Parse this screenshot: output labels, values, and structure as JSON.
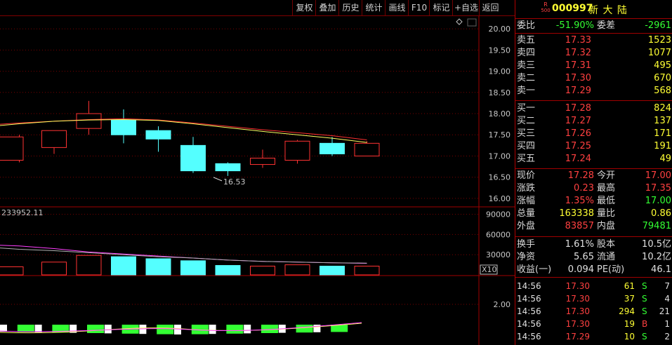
{
  "toolbar": {
    "buttons": [
      "复权",
      "叠加",
      "历史",
      "统计",
      "画线",
      "F10",
      "标记",
      "+自选",
      "返回"
    ]
  },
  "stock": {
    "badge_top": "R",
    "badge_bottom": "500",
    "code": "000997",
    "name": "新 大 陆"
  },
  "price_axis": [
    "20.00",
    "19.50",
    "19.00",
    "18.50",
    "18.00",
    "17.50",
    "17.00",
    "16.50",
    "16.00"
  ],
  "volume_axis": [
    "90000",
    "60000",
    "30000"
  ],
  "volume_unit": "X10",
  "indicator_axis": [
    "2.00"
  ],
  "min_price_label": "16.53",
  "volume_readout": "233952.11",
  "chart_data": {
    "type": "candlestick",
    "candles": [
      {
        "open": 16.9,
        "close": 17.45,
        "high": 17.5,
        "low": 16.85
      },
      {
        "open": 17.2,
        "close": 17.6,
        "high": 17.6,
        "low": 17.05
      },
      {
        "open": 17.65,
        "close": 18.0,
        "high": 18.3,
        "low": 17.5
      },
      {
        "open": 17.85,
        "close": 17.5,
        "high": 18.1,
        "low": 17.3
      },
      {
        "open": 17.6,
        "close": 17.4,
        "high": 17.7,
        "low": 17.1
      },
      {
        "open": 17.25,
        "close": 16.65,
        "high": 17.45,
        "low": 16.6
      },
      {
        "open": 16.82,
        "close": 16.65,
        "high": 16.85,
        "low": 16.53
      },
      {
        "open": 16.8,
        "close": 16.95,
        "high": 17.15,
        "low": 16.72
      },
      {
        "open": 16.9,
        "close": 17.35,
        "high": 17.38,
        "low": 16.82
      },
      {
        "open": 17.3,
        "close": 17.05,
        "high": 17.45,
        "low": 17.0
      },
      {
        "open": 17.0,
        "close": 17.3,
        "high": 17.35,
        "low": 17.0
      }
    ],
    "volumes": [
      12000,
      19000,
      29000,
      27000,
      24000,
      21000,
      14000,
      13000,
      15000,
      13000,
      13000
    ],
    "ylim": [
      15.8,
      20.3
    ],
    "vol_ylim": [
      0,
      100000
    ]
  },
  "quote": {
    "weibi_label": "委比",
    "weibi": "-51.90%",
    "weicha_label": "委差",
    "weicha": "-2961",
    "asks": [
      {
        "label": "卖五",
        "price": "17.33",
        "vol": "1523"
      },
      {
        "label": "卖四",
        "price": "17.32",
        "vol": "1077"
      },
      {
        "label": "卖三",
        "price": "17.31",
        "vol": "495"
      },
      {
        "label": "卖二",
        "price": "17.30",
        "vol": "670"
      },
      {
        "label": "卖一",
        "price": "17.29",
        "vol": "568"
      }
    ],
    "bids": [
      {
        "label": "买一",
        "price": "17.28",
        "vol": "824"
      },
      {
        "label": "买二",
        "price": "17.27",
        "vol": "137"
      },
      {
        "label": "买三",
        "price": "17.26",
        "vol": "171"
      },
      {
        "label": "买四",
        "price": "17.25",
        "vol": "191"
      },
      {
        "label": "买五",
        "price": "17.24",
        "vol": "49"
      }
    ],
    "stats": [
      {
        "l1": "现价",
        "v1": "17.28",
        "c1": "red",
        "l2": "今开",
        "v2": "17.00",
        "c2": "red"
      },
      {
        "l1": "涨跌",
        "v1": "0.23",
        "c1": "red",
        "l2": "最高",
        "v2": "17.35",
        "c2": "red"
      },
      {
        "l1": "涨幅",
        "v1": "1.35%",
        "c1": "red",
        "l2": "最低",
        "v2": "17.00",
        "c2": "green"
      },
      {
        "l1": "总量",
        "v1": "163338",
        "c1": "yellow",
        "l2": "量比",
        "v2": "0.86",
        "c2": "yellow"
      },
      {
        "l1": "外盘",
        "v1": "83857",
        "c1": "red",
        "l2": "内盘",
        "v2": "79481",
        "c2": "green"
      }
    ],
    "fin": [
      {
        "l1": "换手",
        "v1": "1.61%",
        "l2": "股本",
        "v2": "10.5亿"
      },
      {
        "l1": "净资",
        "v1": "5.65",
        "l2": "流通",
        "v2": "10.2亿"
      },
      {
        "l1": "收益(一)",
        "v1": "0.094",
        "l2": "PE(动)",
        "v2": "46.1"
      }
    ],
    "ticks": [
      {
        "time": "14:56",
        "price": "17.30",
        "vol": "61",
        "side": "S",
        "n": "7"
      },
      {
        "time": "14:56",
        "price": "17.30",
        "vol": "37",
        "side": "S",
        "n": "4"
      },
      {
        "time": "14:56",
        "price": "17.30",
        "vol": "294",
        "side": "S",
        "n": "21"
      },
      {
        "time": "14:56",
        "price": "17.30",
        "vol": "19",
        "side": "B",
        "n": "1"
      },
      {
        "time": "14:56",
        "price": "17.29",
        "vol": "10",
        "side": "S",
        "n": "2"
      }
    ]
  }
}
